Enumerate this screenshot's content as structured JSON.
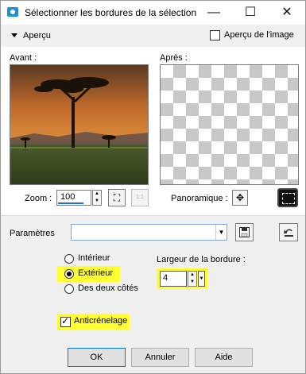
{
  "window": {
    "title": "Sélectionner les bordures de la sélection"
  },
  "titlebar": {
    "minimize": "—",
    "maximize": "☐",
    "close": "✕"
  },
  "apercu": {
    "label": "Aperçu",
    "image_preview_label": "Aperçu de l'image",
    "image_preview_checked": false
  },
  "preview": {
    "before_label": "Avant :",
    "after_label": "Après :"
  },
  "zoom": {
    "label": "Zoom :",
    "value": "100",
    "fit_icon": "fit-window-icon",
    "one_to_one_label": "1:1"
  },
  "pan": {
    "label": "Panoramique :",
    "move_icon": "✥"
  },
  "params": {
    "label": "Paramètres",
    "preset_value": ""
  },
  "options": {
    "radio_interior": "Intérieur",
    "radio_exterior": "Extérieur",
    "radio_both": "Des deux côtés",
    "selected": "Extérieur",
    "width_label": "Largeur de la bordure :",
    "width_value": "4",
    "antialias_label": "Anticrénelage",
    "antialias_checked": true
  },
  "buttons": {
    "ok": "OK",
    "cancel": "Annuler",
    "help": "Aide"
  },
  "colors": {
    "highlight": "#ffff33",
    "accent": "#1e6fd9"
  }
}
